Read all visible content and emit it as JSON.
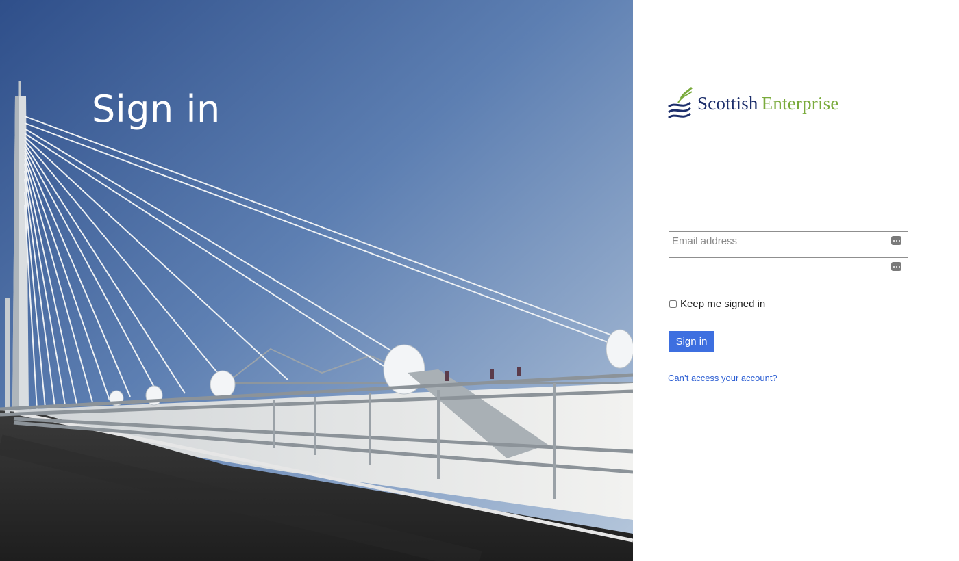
{
  "hero": {
    "title": "Sign in",
    "image": "cable-stayed-bridge-photo"
  },
  "brand": {
    "logo_icon": "waves-logo-icon",
    "name_part1": "Scottish",
    "name_part2": "Enterprise",
    "color_primary": "#1c2e6b",
    "color_secondary": "#7aab3c"
  },
  "form": {
    "email_placeholder": "Email address",
    "email_value": "",
    "password_placeholder": "",
    "password_value": "",
    "field_icon": "password-manager-key-icon",
    "keep_signed_in_label": "Keep me signed in",
    "keep_signed_in_checked": false,
    "submit_label": "Sign in",
    "submit_color": "#3d6fe0",
    "cant_access_label": "Can’t access your account?"
  }
}
